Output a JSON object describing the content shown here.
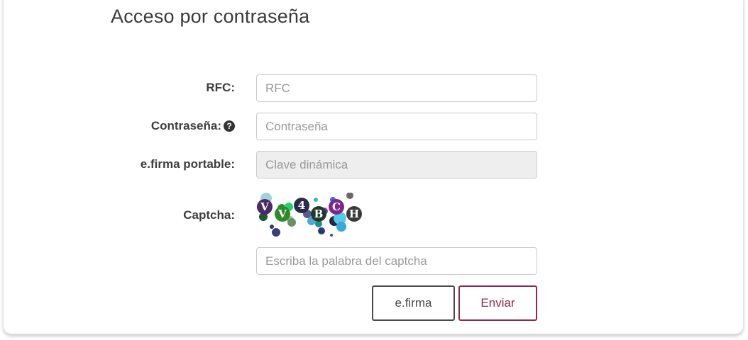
{
  "title": "Acceso por contraseña",
  "form": {
    "rfc_label": "RFC:",
    "rfc_placeholder": "RFC",
    "password_label": "Contraseña:",
    "password_help_icon": "question-circle-icon",
    "password_placeholder": "Contraseña",
    "efirma_portable_label": "e.firma portable:",
    "efirma_portable_placeholder": "Clave dinámica",
    "captcha_label": "Captcha:",
    "captcha_chars": [
      "V",
      "V",
      "4",
      "B",
      "C",
      "H"
    ],
    "captcha_placeholder": "Escriba la palabra del captcha"
  },
  "buttons": {
    "efirma": "e.firma",
    "enviar": "Enviar"
  },
  "colors": {
    "accent": "#8b2b4e",
    "disabled_bg": "#eeeeee",
    "text": "#3e3e3e"
  }
}
